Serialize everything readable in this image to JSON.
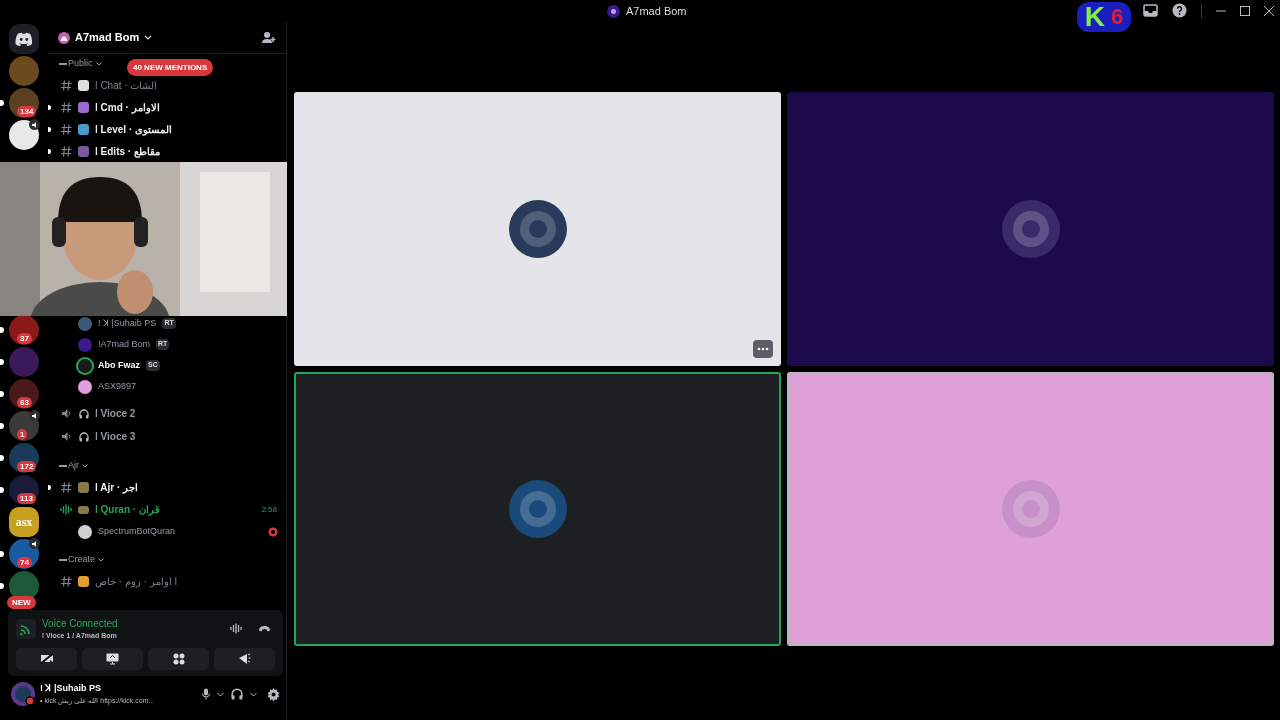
{
  "title_bar": {
    "server": "A7mad Bom",
    "overlay_logo": {
      "letter": "K",
      "number": "6"
    }
  },
  "server_rail": {
    "top": [
      {
        "kind": "home"
      },
      {
        "kind": "server",
        "color": "#6b4a1e",
        "unread": false
      },
      {
        "kind": "server",
        "color": "#5c4020",
        "badge": "134",
        "unread": true
      },
      {
        "kind": "server",
        "color": "#e8e8e8",
        "speaker": true,
        "unread": false
      }
    ],
    "bottom": [
      {
        "kind": "server",
        "color": "#8a1a1a",
        "badge": "37",
        "unread": true
      },
      {
        "kind": "server",
        "color": "#3a1a5a",
        "unread": true
      },
      {
        "kind": "server",
        "color": "#4a1a1a",
        "badge": "63",
        "unread": true
      },
      {
        "kind": "server",
        "color": "#3a3a3a",
        "badge": "1",
        "speaker": true,
        "unread": true
      },
      {
        "kind": "server",
        "color": "#1a3a5a",
        "badge": "172",
        "unread": true
      },
      {
        "kind": "server",
        "color": "#1a1a3a",
        "badge": "113",
        "unread": true
      },
      {
        "kind": "text_logo",
        "color": "#c8a020",
        "label": "asx",
        "unread": false
      },
      {
        "kind": "server",
        "color": "#1a5aa0",
        "badge": "74",
        "speaker": true,
        "unread": true
      },
      {
        "kind": "server",
        "color": "#1a5a3a",
        "new": "NEW",
        "unread": true
      }
    ]
  },
  "channel_panel": {
    "server_name": "A7mad Bom",
    "mentions_pill": "40 NEW MENTIONS",
    "top": [
      {
        "kind": "category",
        "name": "Public"
      },
      {
        "kind": "text",
        "name": "ǀ Chat · الشات",
        "unread": false,
        "color": "#e0e0e0"
      },
      {
        "kind": "text",
        "name": "ǀ Cmd · الاوامر",
        "unread": true,
        "color": "#9a6ad0"
      },
      {
        "kind": "text",
        "name": "ǀ Level · المستوى",
        "unread": true,
        "color": "#4a9ad0"
      },
      {
        "kind": "text",
        "name": "ǀ Edits · مقاطع",
        "unread": true,
        "color": "#7a5a9a"
      }
    ],
    "bottom": [
      {
        "kind": "voice_user",
        "name": "! ꓘ |Suhaib PS",
        "tag": "RT",
        "color": "#3a5a7a",
        "speaking": false
      },
      {
        "kind": "voice_user",
        "name": "!A7mad Bom",
        "tag": "RT",
        "color": "#3a1a8a",
        "speaking": false
      },
      {
        "kind": "voice_user",
        "name": "Abo Fwaz",
        "tag": "SC",
        "color": "#1a1a1a",
        "speaking": true
      },
      {
        "kind": "voice_user",
        "name": "ASX9897",
        "color": "#e0a0e0",
        "speaking": false
      },
      {
        "kind": "voice",
        "name": "ǀ Vioce 2",
        "active": false
      },
      {
        "kind": "voice",
        "name": "ǀ Vioce 3",
        "active": false
      },
      {
        "kind": "category",
        "name": "Ajr"
      },
      {
        "kind": "text",
        "name": "ǀ Ajr · اجر",
        "unread": true,
        "color": "#8a7a4a"
      },
      {
        "kind": "voice",
        "name": "ǀ Quran · قران",
        "active": true,
        "time": "2:58"
      },
      {
        "kind": "voice_user",
        "name": "SpectrumBotQuran",
        "color": "#d0d0d0",
        "speaking": false,
        "live": true
      },
      {
        "kind": "category",
        "name": "Create"
      },
      {
        "kind": "text",
        "name": "اوامر · روم · خاص ǀ",
        "unread": false,
        "color": "#e0a030"
      }
    ]
  },
  "voice_panel": {
    "status": "Voice Connected",
    "channel": "ǀ Vioce 1 / A7mad Bom"
  },
  "user_panel": {
    "name": "! ꓘ |Suhaib PS",
    "status": "• kick الله على ربش https://kick.com..."
  },
  "tiles": [
    {
      "color": "#e3e5e8",
      "avatar": {
        "color": "#2a3a5a"
      },
      "speaking": false,
      "focused": false,
      "hovered": true
    },
    {
      "color": "#1c0a4a",
      "avatar": {
        "color": "#3a2a6a"
      },
      "speaking": false,
      "focused": false,
      "hovered": false
    },
    {
      "color": "#1e1f22",
      "avatar": {
        "color": "#1a4a7a"
      },
      "speaking": true,
      "focused": false,
      "hovered": false
    },
    {
      "color": "#dfa0d8",
      "avatar": {
        "color": "#c890c8"
      },
      "speaking": false,
      "focused": true,
      "hovered": false
    }
  ]
}
